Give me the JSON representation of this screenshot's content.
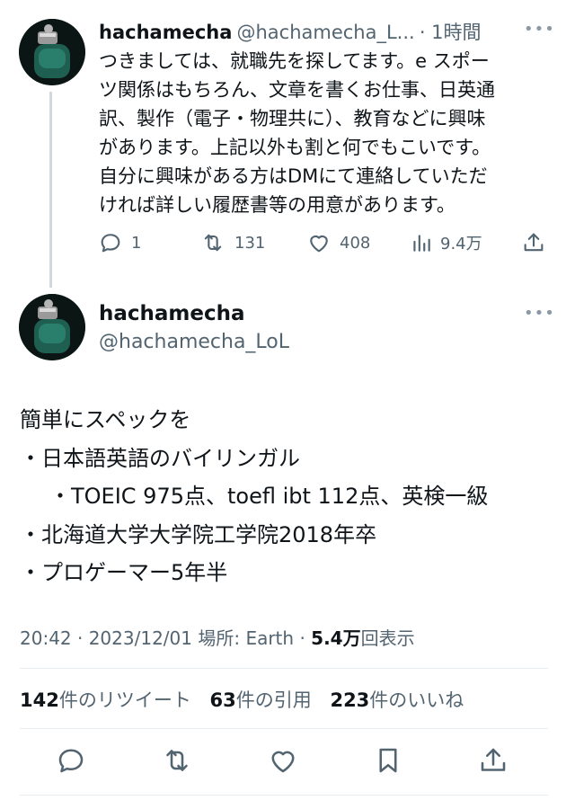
{
  "reply_tweet": {
    "name": "hachamecha",
    "handle": "@hachamecha_L...",
    "time": "· 1時間",
    "more": "•••",
    "text_lines": [
      "つきましては、就職先を探してます。e スポー",
      "ツ関係はもちろん、文章を書くお仕事、日英通",
      "訳、製作（電子・物理共に）、教育などに興味",
      "があります。上記以外も割と何でもこいです。",
      "自分に興味がある方はDMにて連絡していただ",
      "ければ詳しい履歴書等の用意があります。"
    ],
    "actions": {
      "reply_count": "1",
      "retweet_count": "131",
      "like_count": "408",
      "view_count": "9.4万"
    }
  },
  "main_tweet": {
    "name": "hachamecha",
    "handle": "@hachamecha_LoL",
    "more": "•••",
    "text_lines": [
      "簡単にスペックを",
      "・日本語英語のバイリンガル",
      "・TOEIC 975点、toefl ibt 112点、英検一級",
      "・北海道大学大学院工学院2018年卒",
      "・プロゲーマー5年半"
    ],
    "meta": {
      "time_date": "20:42 · 2023/12/01",
      "location": "場所: Earth",
      "dot": "·",
      "views_number": "5.4万",
      "views_label": "回表示"
    },
    "stats": {
      "retweets_number": "142",
      "retweets_label": "件のリツイート",
      "quotes_number": "63",
      "quotes_label": "件の引用",
      "likes_number": "223",
      "likes_label": "件のいいね"
    }
  },
  "icons": [
    "reply-icon",
    "retweet-icon",
    "like-icon",
    "views-icon",
    "share-icon",
    "bookmark-icon",
    "more-icon"
  ]
}
